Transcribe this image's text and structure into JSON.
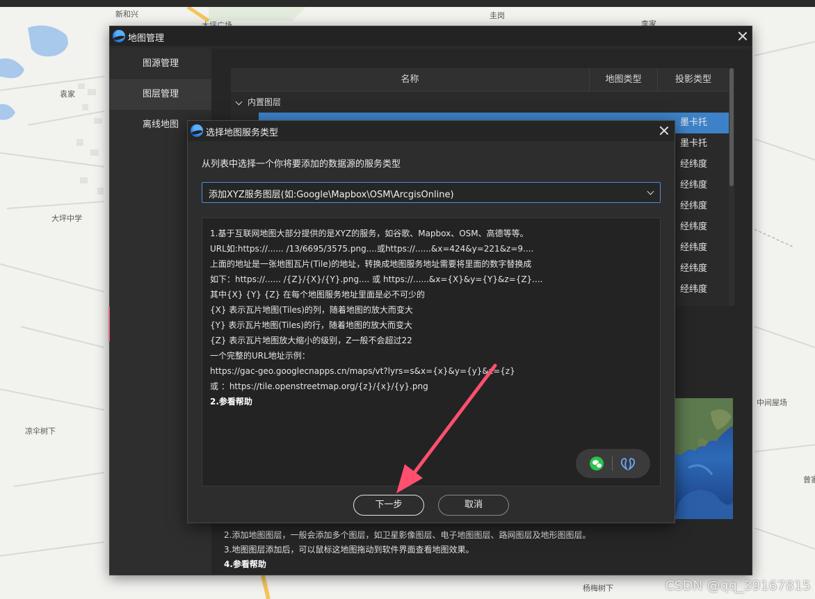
{
  "map": {
    "labels": [
      "新和兴",
      "大坪广场",
      "圭岗",
      "李家",
      "袁家",
      "大坪中学",
      "凉伞树下",
      "中间屋场",
      "曾家",
      "杨梅树下"
    ]
  },
  "watermark": "CSDN @qq_39167815",
  "main_window": {
    "title": "地图管理",
    "sidebar": [
      {
        "label": "图源管理",
        "active": false
      },
      {
        "label": "图层管理",
        "active": true
      },
      {
        "label": "离线地图",
        "active": false
      }
    ],
    "table": {
      "columns": [
        "名称",
        "地图类型",
        "投影类型"
      ],
      "group": "内置图层",
      "projection_values": [
        "墨卡托",
        "墨卡托",
        "经纬度",
        "经纬度",
        "经纬度",
        "经纬度",
        "经纬度",
        "经纬度",
        "经纬度"
      ]
    },
    "notes": [
      "2.添加地图图层，一般会添加多个图层，如卫星影像图层、电子地图图层、路网图层及地形图图层。",
      "3.地图图层添加后，可以鼠标这地图拖动到软件界面查看地图效果。",
      "4.参看帮助"
    ]
  },
  "dialog": {
    "title": "选择地图服务类型",
    "prompt": "从列表中选择一个你将要添加的数据源的服务类型",
    "service_type": {
      "selected": "添加XYZ服务图层(如:Google\\Mapbox\\OSM\\ArcgisOnline)"
    },
    "help_lines": [
      "1.基于互联网地图大部分提供的是XYZ的服务，如谷歌、Mapbox、OSM、高德等等。",
      "URL如:https://...... /13/6695/3575.png....或https://......&x=424&y=221&z=9....",
      "上面的地址是一张地图瓦片(Tile)的地址，转换成地图服务地址需要将里面的数字替换成",
      "如下：https://...... /{Z}/{X}/{Y}.png.... 或 https://......&x={X}&y={Y}&z={Z}....",
      "其中{X} {Y} {Z} 在每个地图服务地址里面是必不可少的",
      "{X} 表示瓦片地图(Tiles)的列，随着地图的放大而变大",
      "{Y} 表示瓦片地图(Tiles)的行，随着地图的放大而变大",
      "{Z} 表示瓦片地图放大缩小的级别，Z一般不会超过22",
      "一个完整的URL地址示例：",
      "https://gac-geo.googlecnapps.cn/maps/vt?lyrs=s&x={x}&y={y}&z={z}",
      "或 ：https://tile.openstreetmap.org/{z}/{x}/{y}.png",
      "2.参看帮助"
    ],
    "buttons": {
      "next": "下一步",
      "cancel": "取消"
    },
    "colors": {
      "accent": "#3d82c8",
      "arrow": "#ff4f6e",
      "wechat": "#2bc34c"
    }
  }
}
